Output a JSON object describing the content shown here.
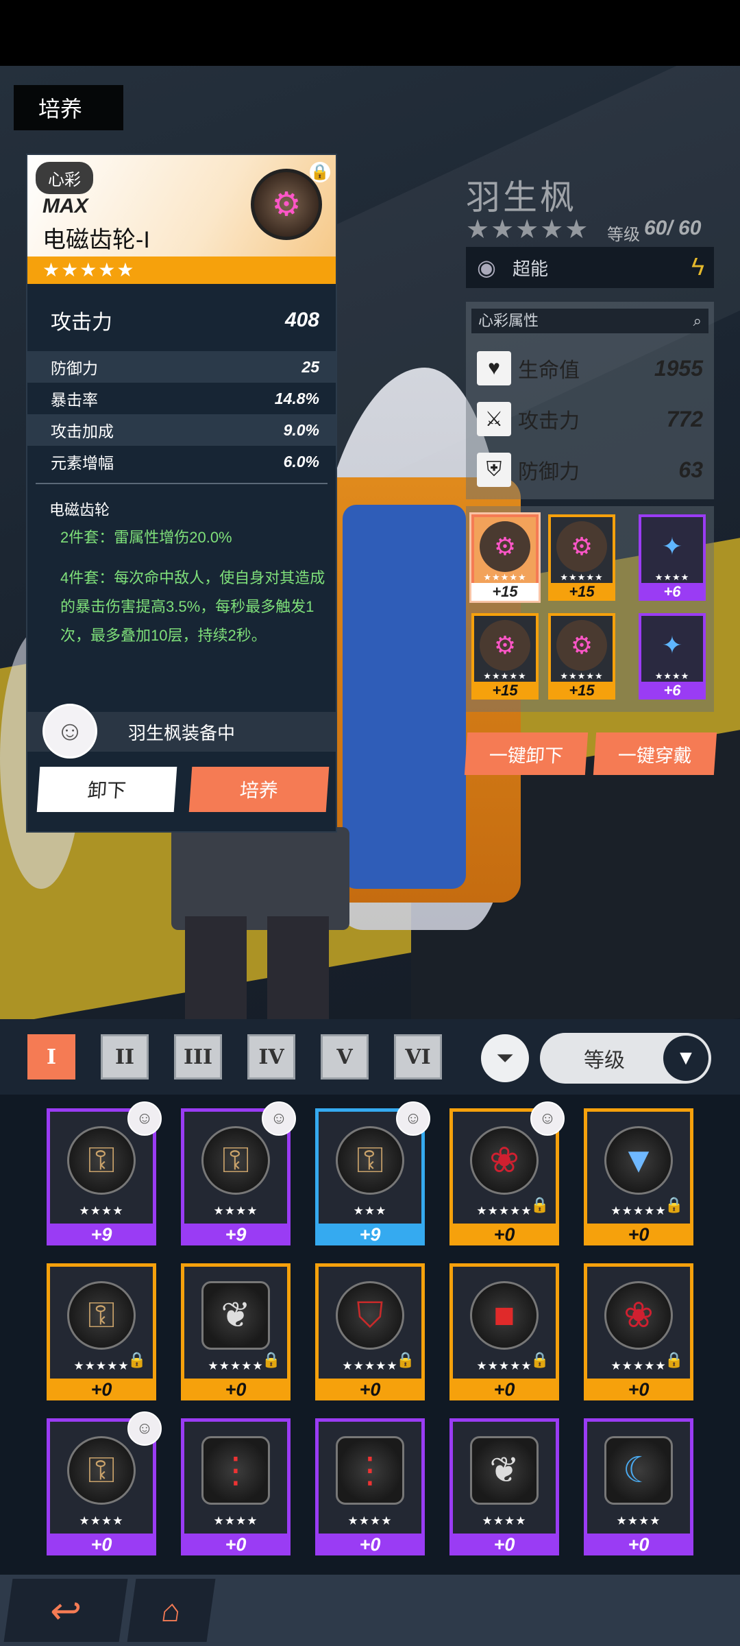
{
  "section_title": "培养",
  "equip_card": {
    "tag": "心彩",
    "max_label": "MAX",
    "name": "电磁齿轮-I",
    "stars": "★★★★★",
    "lock_icon": "lock-icon",
    "main_stat": {
      "label": "攻击力",
      "value": "408"
    },
    "sub_stats": [
      {
        "label": "防御力",
        "value": "25"
      },
      {
        "label": "暴击率",
        "value": "14.8%"
      },
      {
        "label": "攻击加成",
        "value": "9.0%"
      },
      {
        "label": "元素增幅",
        "value": "6.0%"
      }
    ],
    "set_name": "电磁齿轮",
    "set_2": "2件套：雷属性增伤20.0%",
    "set_4": "4件套：每次命中敌人，使自身对其造成的暴击伤害提高3.5%，每秒最多触发1次，最多叠加10层，持续2秒。",
    "equipped_text": "羽生枫装备中",
    "unequip_label": "卸下",
    "train_label": "培养"
  },
  "character": {
    "name": "羽生枫",
    "stars": "★★★★★",
    "level_label": "等级",
    "level": "60/ 60",
    "element": "超能"
  },
  "attributes": {
    "header": "心彩属性",
    "rows": [
      {
        "label": "生命值",
        "value": "1955",
        "icon": "heart-pulse-icon"
      },
      {
        "label": "攻击力",
        "value": "772",
        "icon": "sword-icon"
      },
      {
        "label": "防御力",
        "value": "63",
        "icon": "shield-icon"
      }
    ]
  },
  "equipped_slots": [
    {
      "stars": "★★★★★",
      "level": "+15",
      "icon": "gear-icon",
      "rarity": "orange",
      "selected": true
    },
    {
      "stars": "★★★★★",
      "level": "+15",
      "icon": "gear-icon",
      "rarity": "orange"
    },
    {
      "stars": "★★★★",
      "level": "+6",
      "icon": "fish-icon",
      "rarity": "purple"
    },
    {
      "stars": "★★★★★",
      "level": "+15",
      "icon": "gear-icon",
      "rarity": "orange"
    },
    {
      "stars": "★★★★★",
      "level": "+15",
      "icon": "gear-icon",
      "rarity": "orange"
    },
    {
      "stars": "★★★★",
      "level": "+6",
      "icon": "fish-icon",
      "rarity": "purple"
    }
  ],
  "actions": {
    "unequip_all": "一键卸下",
    "equip_all": "一键穿戴"
  },
  "slot_tabs": [
    "I",
    "II",
    "III",
    "IV",
    "V",
    "VI"
  ],
  "active_tab": "I",
  "sort": {
    "label": "等级"
  },
  "inventory": [
    {
      "stars": "★★★★",
      "level": "+9",
      "icon": "wind-up-key-icon",
      "rarity": "purple",
      "owner": true
    },
    {
      "stars": "★★★★",
      "level": "+9",
      "icon": "wind-up-key-icon",
      "rarity": "purple",
      "owner": true
    },
    {
      "stars": "★★★",
      "level": "+9",
      "icon": "wind-up-key-icon",
      "rarity": "blue",
      "owner": true
    },
    {
      "stars": "★★★★★",
      "level": "+0",
      "icon": "rose-icon",
      "rarity": "orange",
      "owner": true,
      "locked": true
    },
    {
      "stars": "★★★★★",
      "level": "+0",
      "icon": "cup-icon",
      "rarity": "orange",
      "locked": true
    },
    {
      "stars": "★★★★★",
      "level": "+0",
      "icon": "wind-up-key-icon",
      "rarity": "orange",
      "locked": true
    },
    {
      "stars": "★★★★★",
      "level": "+0",
      "icon": "bird-icon",
      "rarity": "orange",
      "locked": true
    },
    {
      "stars": "★★★★★",
      "level": "+0",
      "icon": "armor-icon",
      "rarity": "orange",
      "locked": true
    },
    {
      "stars": "★★★★★",
      "level": "+0",
      "icon": "gift-box-icon",
      "rarity": "orange",
      "locked": true
    },
    {
      "stars": "★★★★★",
      "level": "+0",
      "icon": "rose-icon",
      "rarity": "orange",
      "locked": true
    },
    {
      "stars": "★★★★",
      "level": "+0",
      "icon": "wind-up-key-icon",
      "rarity": "purple",
      "owner": true
    },
    {
      "stars": "★★★★",
      "level": "+0",
      "icon": "traffic-light-icon",
      "rarity": "purple"
    },
    {
      "stars": "★★★★",
      "level": "+0",
      "icon": "traffic-light-icon",
      "rarity": "purple"
    },
    {
      "stars": "★★★★",
      "level": "+0",
      "icon": "bird-icon",
      "rarity": "purple"
    },
    {
      "stars": "★★★★",
      "level": "+0",
      "icon": "scythe-icon",
      "rarity": "purple"
    }
  ],
  "nav": {
    "back_icon": "back-arrow-icon",
    "home_icon": "home-icon"
  }
}
